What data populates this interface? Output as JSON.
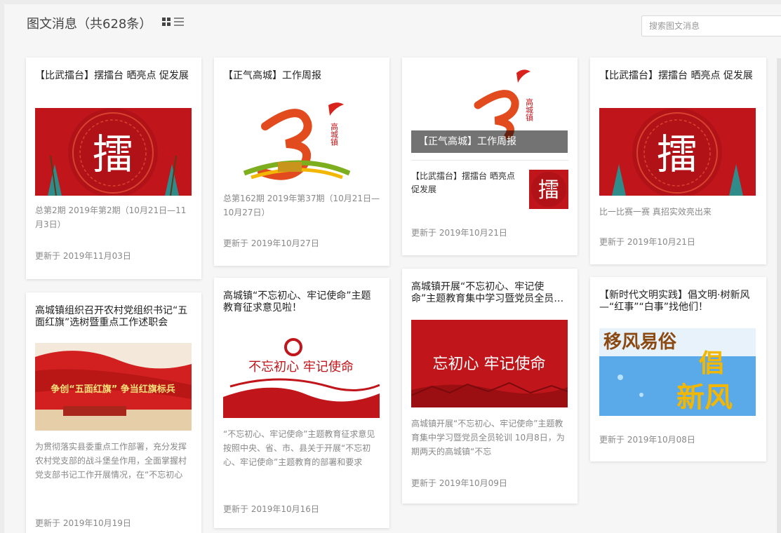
{
  "header": {
    "title": "图文消息（共628条）",
    "search_placeholder": "搜索图文消息"
  },
  "cards": [
    {
      "title": "【比武擂台】摆擂台 晒亮点 促发展",
      "cover_text": "擂",
      "desc": "总第2期 2019年第2期（10月21日—11月3日）",
      "date": "更新于 2019年11月03日"
    },
    {
      "title": "【正气高城】工作周报",
      "logo_text": "高城镇",
      "desc": "总第162期 2019年第37期（10月21日—10月27日）",
      "date": "更新于 2019年10月27日"
    },
    {
      "cover_title": "【正气高城】工作周报",
      "logo_text": "高城镇",
      "sub_title": "【比武擂台】摆擂台 晒亮点 促发展",
      "sub_cover_text": "擂",
      "date": "更新于 2019年10月21日"
    },
    {
      "title": "【比武擂台】摆擂台 晒亮点 促发展",
      "cover_text": "擂",
      "desc": "比一比赛一赛 真招实效亮出来",
      "date": "更新于 2019年10月21日"
    },
    {
      "title": "高城镇组织召开农村党组织书记“五面红旗”选树暨重点工作述职会",
      "cover_text": "争创“五面红旗” 争当红旗标兵",
      "desc": "为贯彻落实县委重点工作部署，充分发挥农村党支部的战斗堡垒作用，全面掌握村党支部书记工作开展情况，在“不忘初心",
      "date": "更新于 2019年10月19日"
    },
    {
      "title": "高城镇“不忘初心、牢记使命”主题教育征求意见啦！",
      "cover_text": "不忘初心 牢记使命",
      "desc": "“不忘初心、牢记使命”主题教育征求意见按照中央、省、市、县关于开展“不忘初心、牢记使命”主题教育的部署和要求",
      "date": "更新于 2019年10月16日"
    },
    {
      "title": "高城镇开展“不忘初心、牢记使命”主题教育集中学习暨党员全员轮训",
      "cover_text": "忘初心 牢记使命",
      "desc": "高城镇开展“不忘初心、牢记使命”主题教育集中学习暨党员全员轮训 10月8日，为期两天的高城镇“不忘",
      "date": "更新于 2019年10月09日"
    },
    {
      "title": "【新时代文明实践】倡文明·树新风—“红事”“白事”找他们！",
      "cover_text_1": "移风易俗",
      "cover_text_2": "倡",
      "cover_text_3": "新风",
      "date": "更新于 2019年10月08日"
    }
  ],
  "colors": {
    "red": "#c0161b",
    "accent_gold": "#f2b705",
    "muted": "#888888"
  }
}
